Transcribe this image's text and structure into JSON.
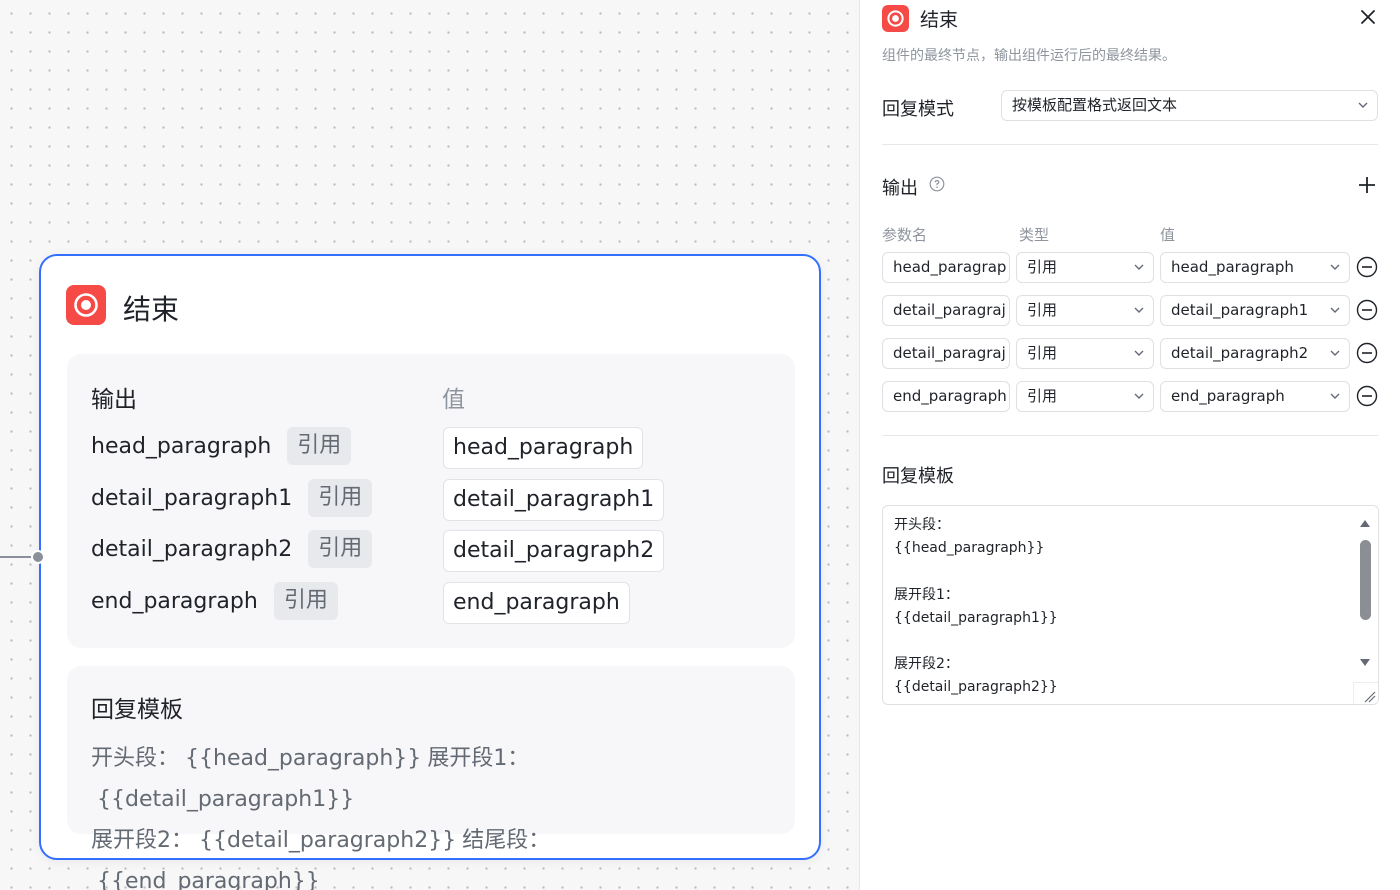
{
  "node": {
    "title": "结束",
    "output_label": "输出",
    "value_label": "值",
    "outputs": [
      {
        "name": "head_paragraph",
        "type": "引用",
        "value": "head_paragraph"
      },
      {
        "name": "detail_paragraph1",
        "type": "引用",
        "value": "detail_paragraph1"
      },
      {
        "name": "detail_paragraph2",
        "type": "引用",
        "value": "detail_paragraph2"
      },
      {
        "name": "end_paragraph",
        "type": "引用",
        "value": "end_paragraph"
      }
    ],
    "template_label": "回复模板",
    "template_line1": {
      "t1": "开头段：",
      "v1": "{{head_paragraph}}",
      "t2": "展开段1：",
      "v2": "{{detail_paragraph1}}"
    },
    "template_line2": {
      "t1": "展开段2：",
      "v1": "{{detail_paragraph2}}",
      "t2": "结尾段：",
      "v2": "{{end_paragraph}}"
    }
  },
  "panel": {
    "title": "结束",
    "description": "组件的最终节点，输出组件运行后的最终结果。",
    "reply_mode_label": "回复模式",
    "reply_mode_value": "按模板配置格式返回文本",
    "output_label": "输出",
    "columns": {
      "name": "参数名",
      "type": "类型",
      "value": "值"
    },
    "params": [
      {
        "name": "head_paragrap",
        "type": "引用",
        "value": "head_paragraph"
      },
      {
        "name": "detail_paragraj",
        "type": "引用",
        "value": "detail_paragraph1"
      },
      {
        "name": "detail_paragraj",
        "type": "引用",
        "value": "detail_paragraph2"
      },
      {
        "name": "end_paragraph",
        "type": "引用",
        "value": "end_paragraph"
      }
    ],
    "template_label": "回复模板",
    "template_text": "开头段：\n{{head_paragraph}}\n\n展开段1：\n{{detail_paragraph1}}\n\n展开段2：\n{{detail_paragraph2}}"
  },
  "colors": {
    "accent": "#3370ff",
    "node_icon": "#f54a45"
  }
}
